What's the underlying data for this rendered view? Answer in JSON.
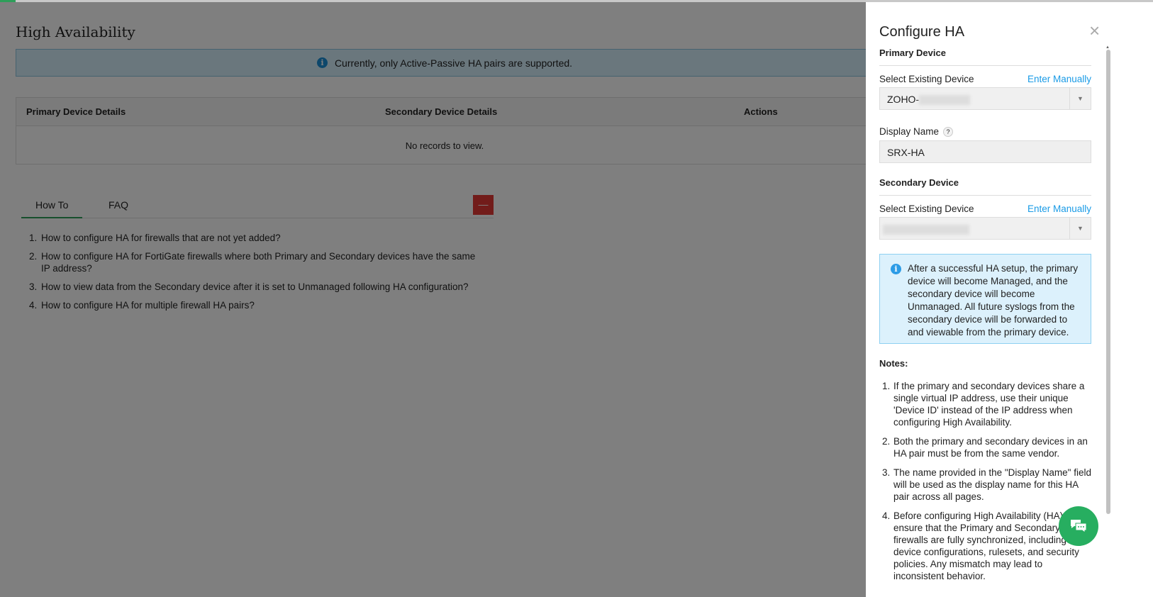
{
  "page": {
    "title": "High Availability",
    "banner": "Currently, only Active-Passive HA pairs are supported.",
    "table": {
      "columns": [
        "Primary Device Details",
        "Secondary Device Details",
        "Actions"
      ],
      "empty": "No records to view."
    },
    "tabs": [
      "How To",
      "FAQ"
    ],
    "collapse_label": "—",
    "howto": [
      "How to configure HA for firewalls that are not yet added?",
      "How to configure HA for FortiGate firewalls where both Primary and Secondary devices have the same IP address?",
      "How to view data from the Secondary device after it is set to Unmanaged following HA configuration?",
      "How to configure HA for multiple firewall HA pairs?"
    ]
  },
  "panel": {
    "title": "Configure HA",
    "close": "×",
    "primary": {
      "heading": "Primary Device",
      "label": "Select Existing Device",
      "link": "Enter Manually",
      "value": "ZOHO-"
    },
    "display_name": {
      "label": "Display Name",
      "help": "?",
      "value": "SRX-HA"
    },
    "secondary": {
      "heading": "Secondary Device",
      "label": "Select Existing Device",
      "link": "Enter Manually"
    },
    "info": "After a successful HA setup, the primary device will become Managed, and the secondary device will become Unmanaged. All future syslogs from the secondary device will be forwarded to and viewable from the primary device.",
    "notes_heading": "Notes:",
    "notes": [
      "If the primary and secondary devices share a single virtual IP address, use their unique 'Device ID' instead of the IP address when configuring High Availability.",
      "Both the primary and secondary devices in an HA pair must be from the same vendor.",
      "The name provided in the \"Display Name\" field will be used as the display name for this HA pair across all pages.",
      "Before configuring High Availability (HA), ensure that the Primary and Secondary firewalls are fully synchronized, including device configurations, rulesets, and security policies. Any mismatch may lead to inconsistent behavior."
    ]
  }
}
